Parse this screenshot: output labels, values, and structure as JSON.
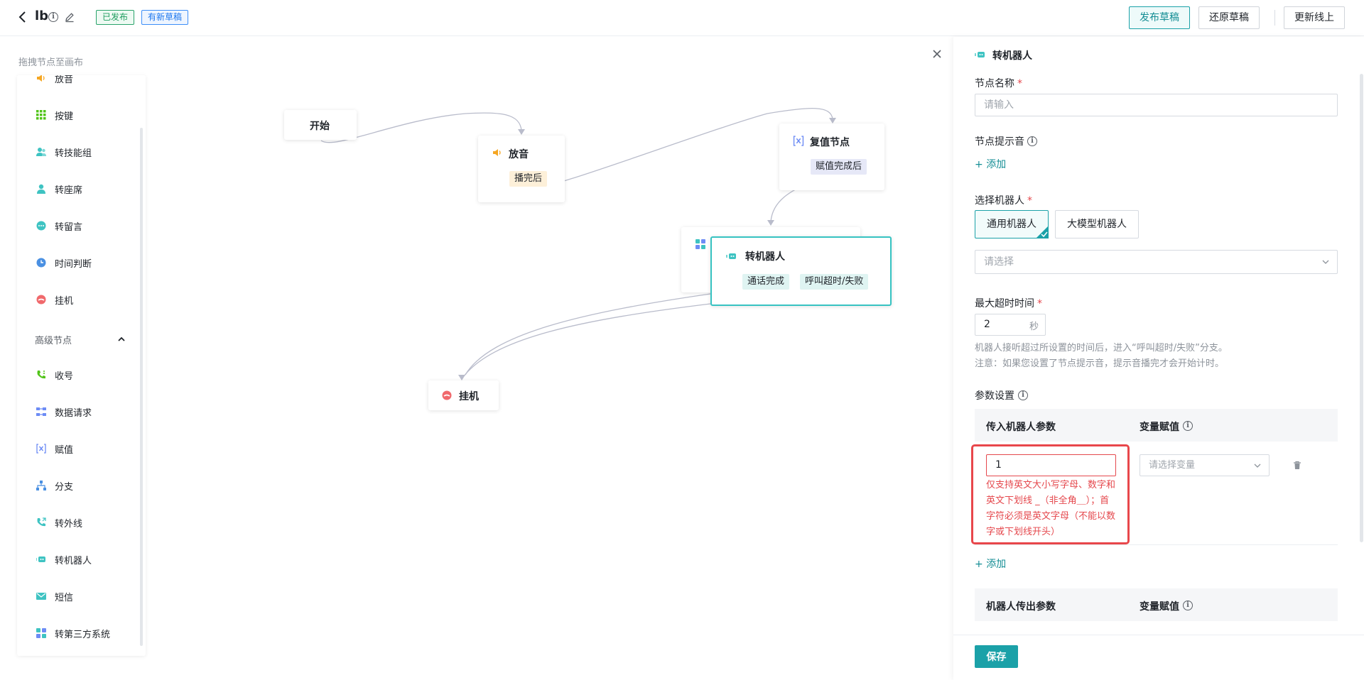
{
  "header": {
    "title": "lb",
    "tag_published": "已发布",
    "tag_draft": "有新草稿",
    "btn_publish_draft": "发布草稿",
    "btn_restore_draft": "还原草稿",
    "btn_update_online": "更新线上"
  },
  "palette": {
    "hint": "拖拽节点至画布",
    "basic_items": [
      "放音",
      "按键",
      "转技能组",
      "转座席",
      "转留言",
      "时间判断",
      "挂机"
    ],
    "advanced_group": "高级节点",
    "advanced_items": [
      "收号",
      "数据请求",
      "赋值",
      "分支",
      "转外线",
      "转机器人",
      "短信",
      "转第三方系统"
    ]
  },
  "canvas": {
    "node_start": "开始",
    "node_play": "放音",
    "chip_play_done": "播完后",
    "node_assign": "复值节点",
    "chip_assign_done": "赋值完成后",
    "node_robot": "转机器人",
    "chip_call_done": "通话完成",
    "chip_call_timeout": "呼叫超时/失败",
    "node_hangup": "挂机"
  },
  "panel": {
    "title": "转机器人",
    "node_name_label": "节点名称",
    "node_name_placeholder": "请输入",
    "prompt_label": "节点提示音",
    "add_label": "添加",
    "robot_select_label": "选择机器人",
    "robot_opt_general": "通用机器人",
    "robot_opt_llm": "大模型机器人",
    "robot_select_placeholder": "请选择",
    "timeout_label": "最大超时时间",
    "timeout_value": "2",
    "timeout_unit": "秒",
    "timeout_hint1": "机器人接听超过所设置的时间后，进入“呼叫超时/失败”分支。",
    "timeout_hint2": "注意：如果您设置了节点提示音，提示音播完才会开始计时。",
    "params_label": "参数设置",
    "in_param_header": "传入机器人参数",
    "var_assign_header": "变量赋值",
    "in_param_value": "1",
    "in_param_error": "仅支持英文大小写字母、数字和英文下划线 _（非全角＿）；首字符必须是英文字母（不能以数字或下划线开头）",
    "var_select_placeholder": "请选择变量",
    "out_param_header": "机器人传出参数",
    "out_var_assign_header": "变量赋值",
    "save_label": "保存"
  },
  "colors": {
    "accent": "#1ba1a8",
    "error": "#e5484d",
    "published": "#1f9d5f",
    "draft": "#1f78ef"
  }
}
